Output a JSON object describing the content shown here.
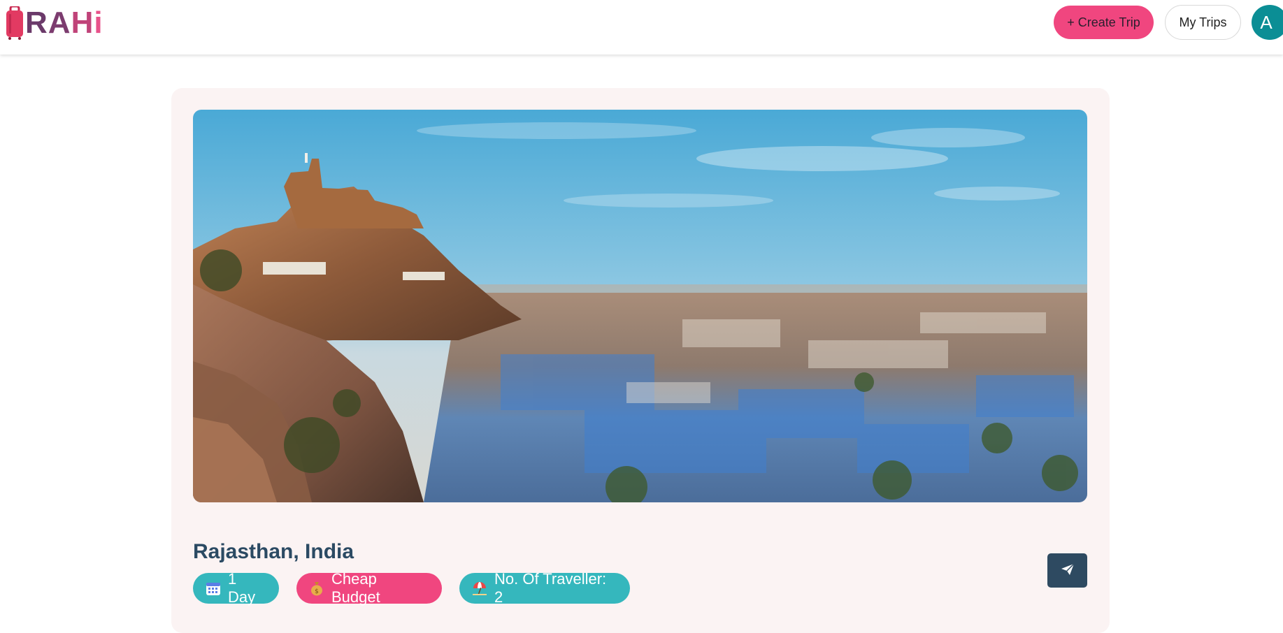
{
  "header": {
    "logo": {
      "letters": [
        "R",
        "A",
        "H",
        "i"
      ]
    },
    "create_trip_label": "+ Create Trip",
    "my_trips_label": "My Trips",
    "avatar_initial": "A"
  },
  "trip": {
    "place": "Rajasthan, India",
    "chips": {
      "days": "1 Day",
      "budget": "Cheap Budget",
      "travellers": "No. Of Traveller: 2"
    }
  },
  "colors": {
    "brand_pink": "#f0467f",
    "brand_purple": "#6b3a6a",
    "teal": "#35b7bd",
    "avatar": "#0b8e95",
    "dark_slate": "#2e4a61",
    "card_bg": "#fbf3f3"
  },
  "icons": {
    "logo": "suitcase-icon",
    "share": "paper-plane-icon",
    "days": "calendar-icon",
    "budget": "money-bag-icon",
    "travellers": "beach-umbrella-icon"
  }
}
